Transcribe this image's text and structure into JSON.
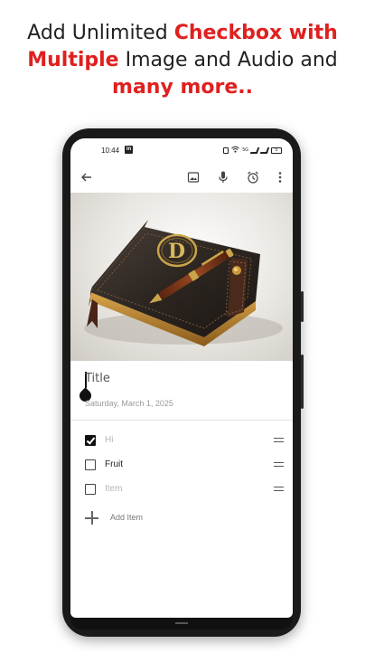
{
  "headline": {
    "line1_plain": "Add Unlimited ",
    "line1_accent": "Checkbox with",
    "line2_accent": "Multiple",
    "line2_plain": " Image and Audio and",
    "line3_accent": "many more.."
  },
  "colors": {
    "accent": "#e02020",
    "text": "#222222",
    "muted": "#b5b5b5"
  },
  "status_bar": {
    "time": "10:44",
    "app_badge": "in",
    "battery": "5"
  },
  "toolbar": {
    "icons": [
      "back-arrow-icon",
      "image-icon",
      "microphone-icon",
      "alarm-clock-icon",
      "more-vertical-icon"
    ]
  },
  "note": {
    "title_placeholder": "Title",
    "date": "Saturday, March 1, 2025",
    "cover_emblem": "D",
    "items": [
      {
        "label": "Hi",
        "checked": true
      },
      {
        "label": "Fruit",
        "checked": false
      },
      {
        "label": "Item",
        "checked": false,
        "placeholder": true
      }
    ],
    "add_item_label": "Add Item"
  }
}
